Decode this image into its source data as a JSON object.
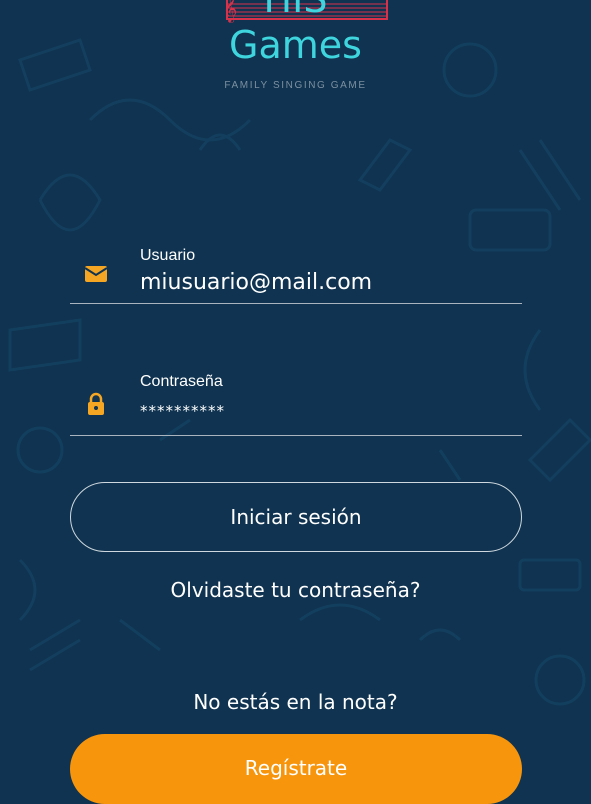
{
  "logo": {
    "title_top": "HIS",
    "title_main": "Games",
    "tagline": "FAMILY SINGING GAME"
  },
  "form": {
    "username": {
      "label": "Usuario",
      "value": "miusuario@mail.com",
      "icon": "envelope-icon"
    },
    "password": {
      "label": "Contraseña",
      "value": "**********",
      "icon": "lock-icon"
    },
    "login_label": "Iniciar sesión",
    "forgot_label": "Olvidaste tu contraseña?"
  },
  "signup": {
    "prompt": "No estás en la nota?",
    "register_label": "Regístrate"
  },
  "colors": {
    "background": "#0f3350",
    "accent": "#f7950d",
    "logo_teal": "#3fd5de",
    "logo_red": "#d8324b",
    "icon_orange": "#f5a623"
  }
}
